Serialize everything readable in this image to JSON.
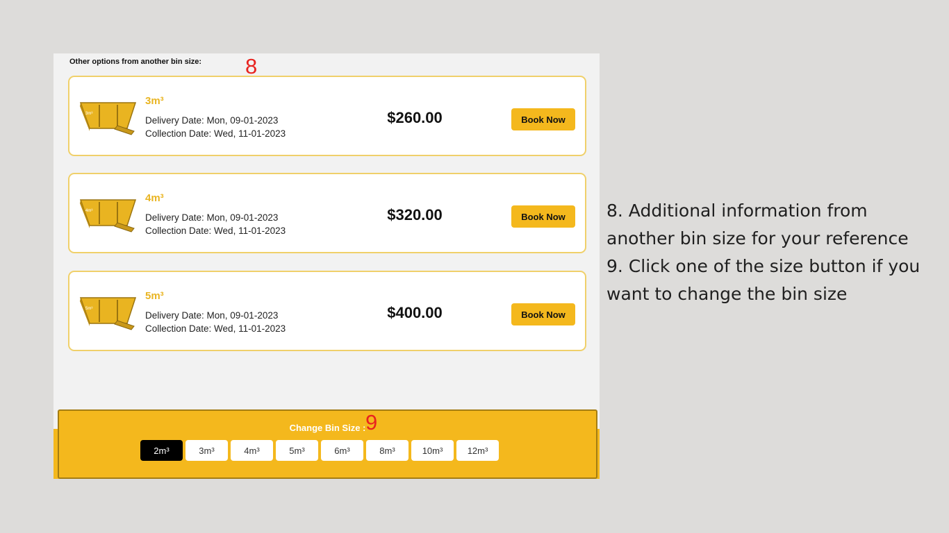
{
  "section_heading": "Other options from another bin size:",
  "markers": {
    "eight": "8",
    "nine": "9"
  },
  "options": [
    {
      "size": "3m³",
      "bin_label": "3m³",
      "delivery": "Delivery Date: Mon, 09-01-2023",
      "collection": "Collection Date: Wed, 11-01-2023",
      "price": "$260.00",
      "button": "Book Now"
    },
    {
      "size": "4m³",
      "bin_label": "4m³",
      "delivery": "Delivery Date: Mon, 09-01-2023",
      "collection": "Collection Date: Wed, 11-01-2023",
      "price": "$320.00",
      "button": "Book Now"
    },
    {
      "size": "5m³",
      "bin_label": "5m³",
      "delivery": "Delivery Date: Mon, 09-01-2023",
      "collection": "Collection Date: Wed, 11-01-2023",
      "price": "$400.00",
      "button": "Book Now"
    }
  ],
  "change_bin": {
    "label": "Change Bin Size :",
    "sizes": [
      "2m³",
      "3m³",
      "4m³",
      "5m³",
      "6m³",
      "8m³",
      "10m³",
      "12m³"
    ],
    "selected": "2m³"
  },
  "notes": [
    "8. Additional information from another bin size for your reference",
    "9. Click one of the size button if you want to change the bin size"
  ],
  "colors": {
    "accent": "#f4b81d",
    "size_text": "#e9b421",
    "card_border": "#f0d06a",
    "marker": "#e8231f",
    "selected_size_bg": "#000000"
  }
}
